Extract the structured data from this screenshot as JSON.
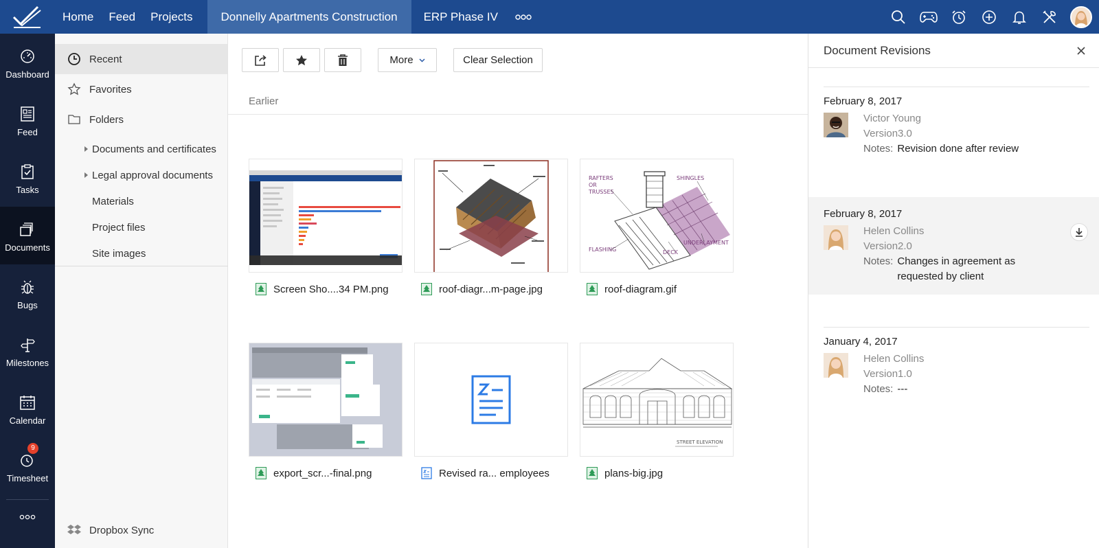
{
  "topbar": {
    "nav": [
      {
        "label": "Home"
      },
      {
        "label": "Feed"
      },
      {
        "label": "Projects"
      },
      {
        "label": "Donnelly Apartments Construction"
      },
      {
        "label": "ERP Phase IV"
      }
    ],
    "actions": [
      "search-icon",
      "gamepad-icon",
      "alarm-clock-icon",
      "plus-circle-icon",
      "bell-icon",
      "tools-icon"
    ],
    "colors": {
      "bar": "#1d4a8f",
      "active_tab": "#3e6aa8"
    }
  },
  "rail": {
    "items": [
      {
        "label": "Dashboard",
        "icon": "gauge-icon"
      },
      {
        "label": "Feed",
        "icon": "newspaper-icon"
      },
      {
        "label": "Tasks",
        "icon": "clipboard-check-icon"
      },
      {
        "label": "Documents",
        "icon": "stacked-folders-icon",
        "active": true
      },
      {
        "label": "Bugs",
        "icon": "bug-icon"
      },
      {
        "label": "Milestones",
        "icon": "signpost-icon"
      },
      {
        "label": "Calendar",
        "icon": "calendar-icon"
      },
      {
        "label": "Timesheet",
        "icon": "stopwatch-icon",
        "badge": "9"
      }
    ]
  },
  "sidenav": {
    "recent": "Recent",
    "favorites": "Favorites",
    "folders": "Folders",
    "subfolders": [
      {
        "label": "Documents and certificates",
        "expandable": true
      },
      {
        "label": "Legal approval documents",
        "expandable": true
      },
      {
        "label": "Materials",
        "expandable": false
      },
      {
        "label": "Project files",
        "expandable": false
      },
      {
        "label": "Site images",
        "expandable": false
      }
    ],
    "dropbox": "Dropbox Sync"
  },
  "toolbar": {
    "more_label": "More",
    "clear_label": "Clear Selection"
  },
  "main": {
    "section": "Earlier",
    "files": [
      {
        "name": "Screen Sho....34 PM.png",
        "type": "image"
      },
      {
        "name": "roof-diagr...m-page.jpg",
        "type": "image"
      },
      {
        "name": "roof-diagram.gif",
        "type": "image"
      },
      {
        "name": "export_scr...-final.png",
        "type": "image"
      },
      {
        "name": "Revised ra... employees",
        "type": "writer-doc"
      },
      {
        "name": "plans-big.jpg",
        "type": "image"
      }
    ],
    "roof_diagram_labels": {
      "rafters": "RAFTERS",
      "or": "OR",
      "trusses": "TRUSSES",
      "shingles": "SHINGLES",
      "flashing": "FLASHING",
      "deck": "DECK",
      "underlayment": "UNDERLAYMENT"
    },
    "plans_label": "STREET ELEVATION"
  },
  "revisions": {
    "title": "Document Revisions",
    "notes_label": "Notes:",
    "items": [
      {
        "date": "February 8, 2017",
        "name": "Victor Young",
        "version": "Version3.0",
        "notes": "Revision done after review"
      },
      {
        "date": "February 8, 2017",
        "name": "Helen Collins",
        "version": "Version2.0",
        "notes": "Changes in agreement as requested by client"
      },
      {
        "date": "January 4, 2017",
        "name": "Helen Collins",
        "version": "Version1.0",
        "notes": "---"
      }
    ]
  }
}
